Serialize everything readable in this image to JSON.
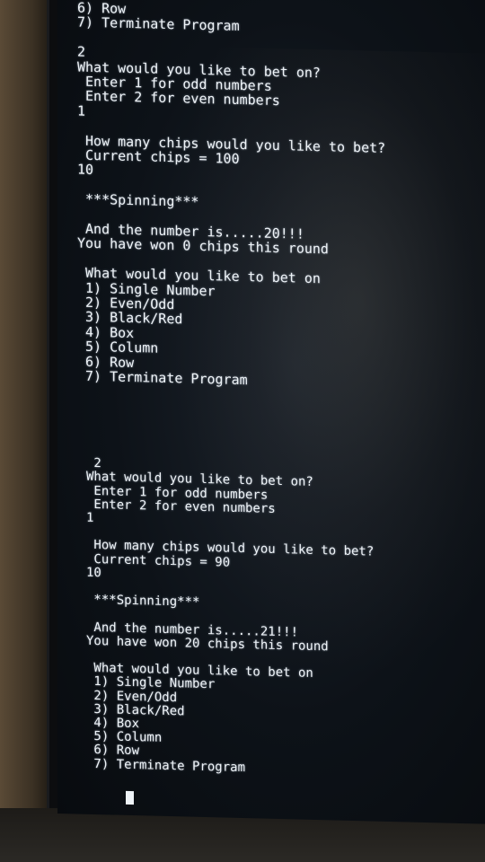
{
  "terminal": {
    "lines": [
      "6) Row",
      "7) Terminate Program",
      "",
      "2",
      "What would you like to bet on?",
      " Enter 1 for odd numbers",
      " Enter 2 for even numbers",
      "1",
      "",
      " How many chips would you like to bet?",
      " Current chips = 100",
      "10",
      "",
      " ***Spinning***",
      "",
      " And the number is.....20!!!",
      "You have won 0 chips this round",
      "",
      " What would you like to bet on",
      " 1) Single Number",
      " 2) Even/Odd",
      " 3) Black/Red",
      " 4) Box",
      " 5) Column",
      " 6) Row",
      " 7) Terminate Program",
      "",
      " 2",
      "What would you like to bet on?",
      " Enter 1 for odd numbers",
      " Enter 2 for even numbers",
      "1",
      "",
      " How many chips would you like to bet?",
      " Current chips = 90",
      "10",
      "",
      " ***Spinning***",
      "",
      " And the number is.....21!!!",
      "You have won 20 chips this round",
      "",
      " What would you like to bet on",
      " 1) Single Number",
      " 2) Even/Odd",
      " 3) Black/Red",
      " 4) Box",
      " 5) Column",
      " 6) Row",
      " 7) Terminate Program"
    ]
  },
  "colors": {
    "text": "#eef3f7",
    "screen_bg": "#0d1218",
    "led": "#39d36a"
  }
}
